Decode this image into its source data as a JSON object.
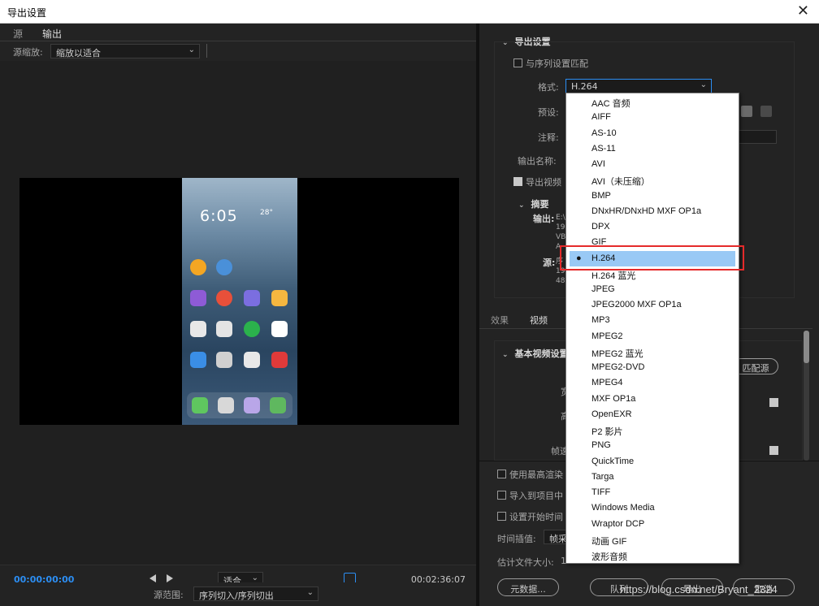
{
  "window": {
    "title": "导出设置",
    "close_icon": "close-icon"
  },
  "left": {
    "tabs": [
      "源",
      "输出"
    ],
    "active_tab": "输出",
    "scale_label": "源缩放:",
    "scale_value": "缩放以适合",
    "phone": {
      "time": "6:05",
      "temp": "28°"
    },
    "timecode_start": "00;00;00;00",
    "timecode_end": "00;02;36;07",
    "fit_value": "适合",
    "range_label": "源范围:",
    "range_value": "序列切入/序列切出"
  },
  "right": {
    "export_settings_title": "导出设置",
    "match_sequence_label": "与序列设置匹配",
    "format_label": "格式:",
    "format_value": "H.264",
    "preset_label": "预设:",
    "comment_label": "注释:",
    "output_name_label": "输出名称:",
    "export_video_label": "导出视频",
    "summary_title": "摘要",
    "summary_output_label": "输出:",
    "summary_output_lines": [
      "E:\\",
      "192",
      "VB",
      "A"
    ],
    "summary_source_label": "源:",
    "summary_source_lines": [
      "序",
      "192",
      "480"
    ],
    "lower_tabs": [
      "效果",
      "视频"
    ],
    "basic_video_title": "基本视频设置",
    "match_source_label": "匹配源",
    "width_label": "宽",
    "height_label": "高",
    "frame_rate_label": "帧速",
    "use_max_render": "使用最高渲染",
    "import_into_project": "导入到项目中",
    "set_start_timecode": "设置开始时间",
    "time_interpolation_label": "时间插值:",
    "time_interpolation_value": "帧采",
    "estimated_size_label": "估计文件大小:",
    "estimated_size_value": "1",
    "metadata_button": "元数据...",
    "queue_button": "队列",
    "export_button": "导出",
    "cancel_button": "取消"
  },
  "format_menu": {
    "items": [
      "AAC 音频",
      "AIFF",
      "AS-10",
      "AS-11",
      "AVI",
      "AVI（未压缩）",
      "BMP",
      "DNxHR/DNxHD MXF OP1a",
      "DPX",
      "GIF",
      "H.264",
      "H.264 蓝光",
      "JPEG",
      "JPEG2000 MXF OP1a",
      "MP3",
      "MPEG2",
      "MPEG2 蓝光",
      "MPEG2-DVD",
      "MPEG4",
      "MXF OP1a",
      "OpenEXR",
      "P2 影片",
      "PNG",
      "QuickTime",
      "Targa",
      "TIFF",
      "Windows Media",
      "Wraptor DCP",
      "动画 GIF",
      "波形音频"
    ],
    "selected": "H.264",
    "selected_marker": "●"
  },
  "watermark": "https://blog.csdn.net/Bryant_2324",
  "colors": {
    "accent": "#2c8ef3",
    "selection": "#99c9f5",
    "highlight_box": "#e52a2a"
  }
}
